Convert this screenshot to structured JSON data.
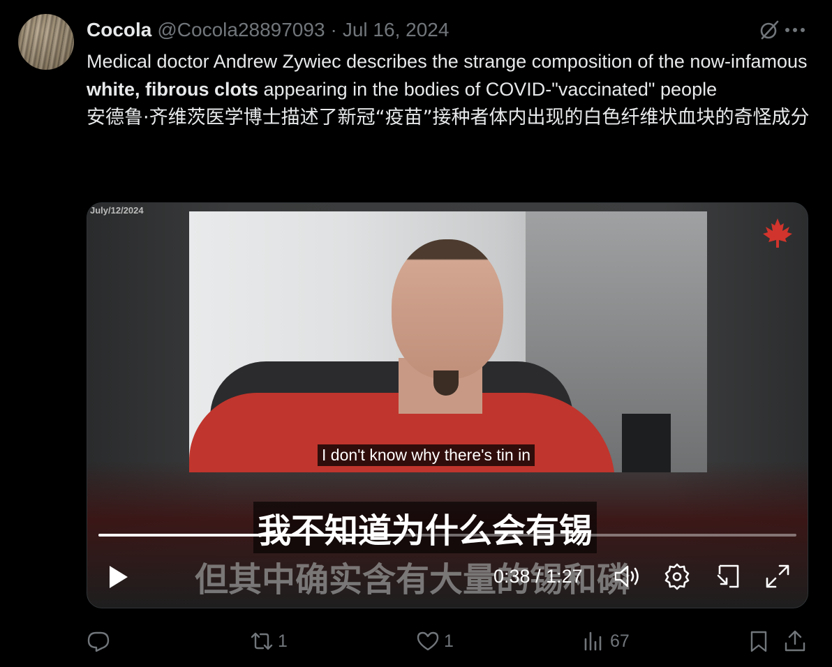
{
  "tweet": {
    "author_name": "Cocola",
    "handle": "@Cocola28897093",
    "separator": "·",
    "date": "Jul 16, 2024",
    "text_en_part1": "Medical doctor Andrew Zywiec describes the strange composition of the now-infamous ",
    "text_en_bold": "white, fibrous clots",
    "text_en_part2": " appearing in the bodies of COVID-\"vaccinated\" people",
    "text_zh": "安德鲁·齐维茨医学博士描述了新冠“疫苗”接种者体内出现的白色纤维状血块的奇怪成分"
  },
  "video": {
    "date_stamp": "July/12/2024",
    "subtitle_en": "I don't know why there's tin in",
    "subtitle_zh_1": "我不知道为什么会有锡",
    "subtitle_zh_2": "但其中确实含有大量的锡和磷",
    "current_time": "0:38",
    "time_separator": " / ",
    "duration": "1:27",
    "progress": 0.437,
    "accent_color": "#d0342c"
  },
  "actions": {
    "reply_count": "",
    "retweet_count": "1",
    "like_count": "1",
    "view_count": "67"
  },
  "icons": [
    "avatar",
    "grok-icon",
    "more-icon",
    "maple-leaf-icon",
    "play-icon",
    "volume-icon",
    "settings-icon",
    "pip-icon",
    "fullscreen-icon",
    "reply-icon",
    "retweet-icon",
    "like-icon",
    "views-icon",
    "bookmark-icon",
    "share-icon"
  ]
}
